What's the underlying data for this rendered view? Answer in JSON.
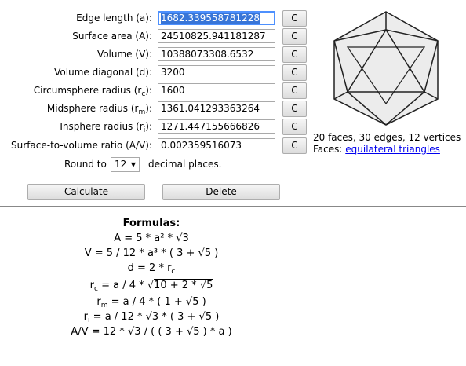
{
  "fields": [
    {
      "label": "Edge length (a):",
      "value": "1682.339558781228"
    },
    {
      "label_main": "Surface area (A):",
      "value": "24510825.941181287"
    },
    {
      "label": "Volume (V):",
      "value": "10388073308.6532"
    },
    {
      "label": "Volume diagonal (d):",
      "value": "3200"
    },
    {
      "label_pre": "Circumsphere radius (r",
      "label_sub": "c",
      "label_post": "):",
      "value": "1600"
    },
    {
      "label_pre": "Midsphere radius (r",
      "label_sub": "m",
      "label_post": "):",
      "value": "1361.041293363264"
    },
    {
      "label_pre": "Insphere radius (r",
      "label_sub": "i",
      "label_post": "):",
      "value": "1271.447155666826"
    },
    {
      "label": "Surface-to-volume ratio (A/V):",
      "value": "0.002359516073"
    }
  ],
  "clear_label": "C",
  "round": {
    "prefix": "Round to",
    "value": "12",
    "suffix": "decimal places."
  },
  "buttons": {
    "calculate": "Calculate",
    "delete": "Delete"
  },
  "info": {
    "counts": "20 faces, 30 edges, 12 vertices",
    "faces_label": "Faces:",
    "faces_link": "equilateral triangles"
  },
  "formulas": {
    "title": "Formulas:",
    "f1": "A = 5 * a² * √3",
    "f2": "V = 5 / 12 * a³ * ( 3 + √5 )",
    "f3_pre": "d = 2 * r",
    "f3_sub": "c",
    "f4_pre": "r",
    "f4_sub": "c",
    "f4_mid": " = a / 4 * √",
    "f4_rad": "10 + 2 * √5",
    "f5_pre": "r",
    "f5_sub": "m",
    "f5_post": " = a / 4 * ( 1 + √5 )",
    "f6_pre": "r",
    "f6_sub": "i",
    "f6_post": " = a / 12 * √3 * ( 3 + √5 )",
    "f7": "A/V = 12 * √3 / ( ( 3 + √5 ) * a )"
  },
  "colors": {
    "selection": "#3875d7",
    "focus_border": "#4d90fe",
    "link": "#0000ee"
  },
  "icons": {
    "shape": "icosahedron-icon",
    "select_arrow": "chevron-down-icon"
  }
}
